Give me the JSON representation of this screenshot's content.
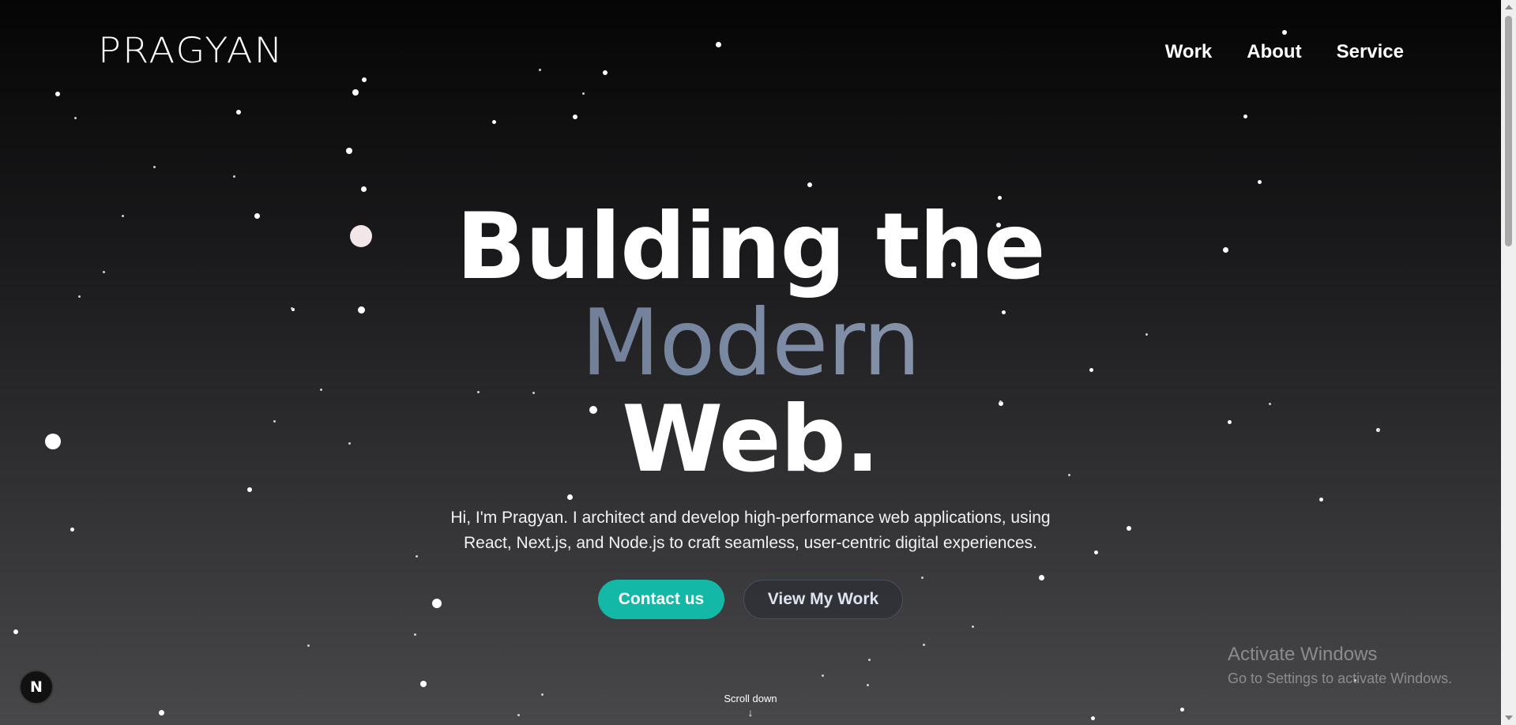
{
  "header": {
    "logo": "PRAGYAN",
    "nav": [
      "Work",
      "About",
      "Service"
    ]
  },
  "hero": {
    "line1": "Bulding the",
    "line2": "Modern",
    "line3": "Web.",
    "subtitle": "Hi, I'm Pragyan. I architect and develop high-performance web applications, using React, Next.js, and Node.js to craft seamless, user-centric digital experiences.",
    "primary_button": "Contact us",
    "secondary_button": "View My Work",
    "scroll_hint": "Scroll down",
    "scroll_arrow": "↓"
  },
  "badge": {
    "label": "N",
    "icon": "nextjs-icon"
  },
  "watermark": {
    "title": "Activate Windows",
    "subtitle": "Go to Settings to activate Windows."
  },
  "colors": {
    "accent": "#14b8a6",
    "background_top": "#050505",
    "background_bottom": "#48484a",
    "modern_gradient_start": "#4d5a70",
    "modern_gradient_end": "#a7adbd"
  }
}
